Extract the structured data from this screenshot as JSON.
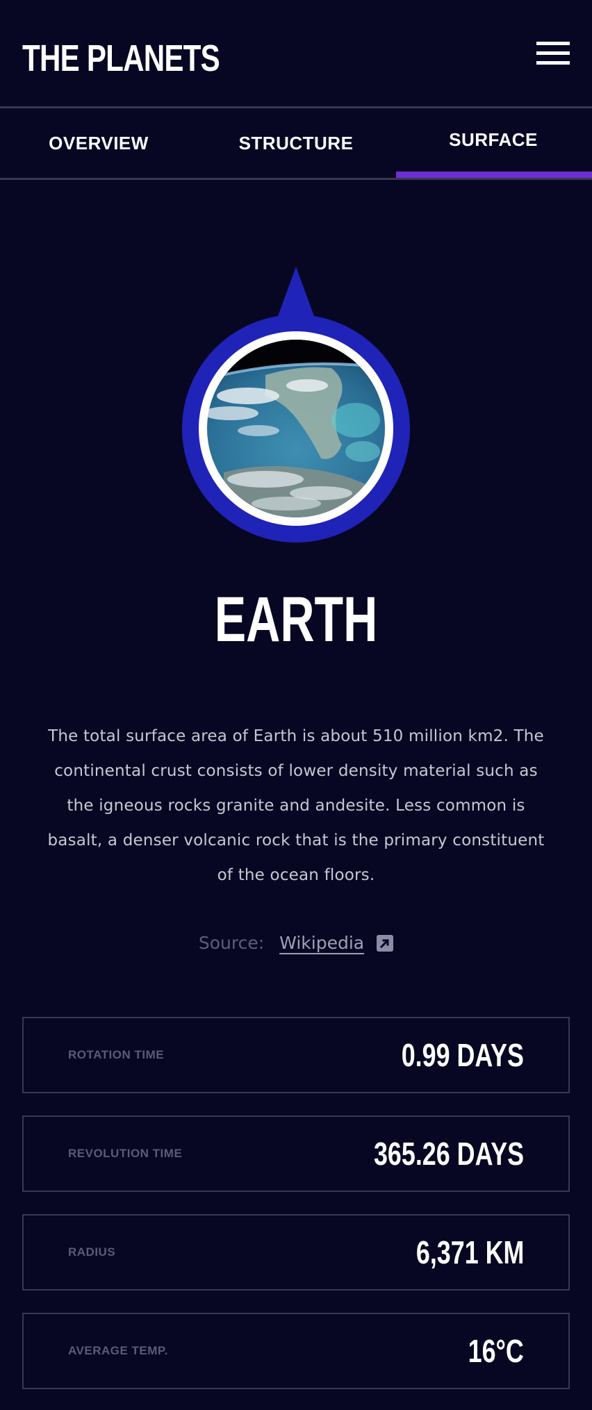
{
  "header": {
    "logo": "THE PLANETS",
    "menu_icon": "hamburger-menu-icon"
  },
  "tabs": [
    {
      "label": "OVERVIEW",
      "active": false
    },
    {
      "label": "STRUCTURE",
      "active": false
    },
    {
      "label": "SURFACE",
      "active": true
    }
  ],
  "planet": {
    "name": "EARTH",
    "description": "The total surface area of Earth is about 510 million km2. The continental crust consists of lower density material such as the igneous rocks granite and andesite. Less common is basalt, a denser volcanic rock that is the primary constituent of the ocean floors.",
    "source_prefix": "Source:",
    "source_link": "Wikipedia",
    "source_icon": "external-link-icon"
  },
  "stats": [
    {
      "label": "ROTATION TIME",
      "value": "0.99 DAYS"
    },
    {
      "label": "REVOLUTION TIME",
      "value": "365.26 DAYS"
    },
    {
      "label": "RADIUS",
      "value": "6,371 KM"
    },
    {
      "label": "AVERAGE TEMP.",
      "value": "16°C"
    }
  ],
  "colors": {
    "background": "#070724",
    "accent": "#6D2ED5",
    "pin": "#1F23B8",
    "border": "#38384F"
  }
}
